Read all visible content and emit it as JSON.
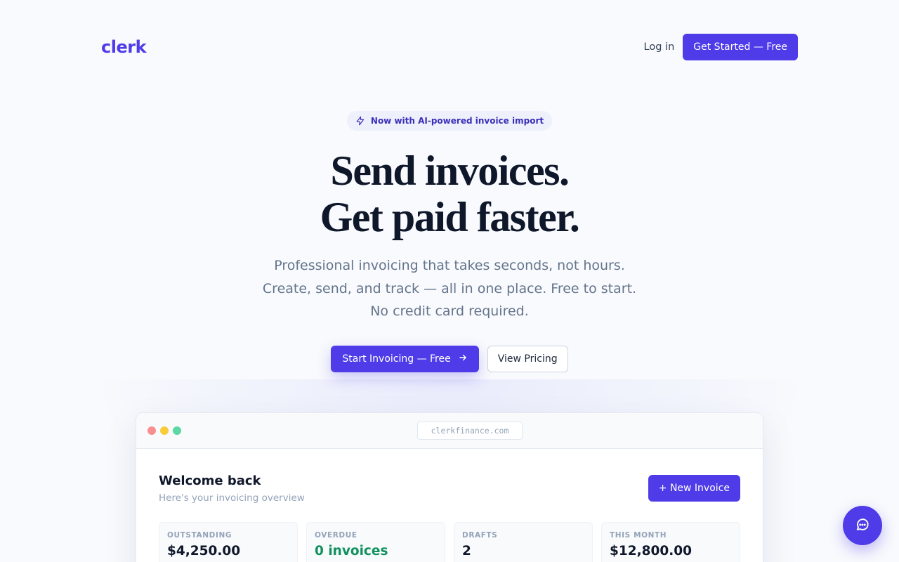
{
  "nav": {
    "logo": "clerk",
    "login_label": "Log in",
    "get_started_label": "Get Started — Free"
  },
  "hero": {
    "badge_text": "Now with AI-powered invoice import",
    "badge_icon": "lightning-icon",
    "headline_line1": "Send invoices.",
    "headline_line2": "Get paid faster.",
    "subtitle_line1": "Professional invoicing that takes seconds, not hours.",
    "subtitle_line2": "Create, send, and track — all in one place. Free to start.",
    "subtitle_line3": "No credit card required.",
    "cta_primary_label": "Start Invoicing — Free",
    "cta_primary_icon": "arrow-right-icon",
    "cta_secondary_label": "View Pricing"
  },
  "preview": {
    "url": "clerkfinance.com",
    "welcome_title": "Welcome back",
    "welcome_subtitle": "Here's your invoicing overview",
    "new_invoice_label": "+ New Invoice",
    "stats": [
      {
        "label": "OUTSTANDING",
        "value": "$4,250.00"
      },
      {
        "label": "OVERDUE",
        "value": "0 invoices"
      },
      {
        "label": "DRAFTS",
        "value": "2"
      },
      {
        "label": "THIS MONTH",
        "value": "$12,800.00"
      }
    ]
  },
  "chat": {
    "icon": "chat-icon"
  },
  "colors": {
    "brand": "#4f3ce8",
    "background": "#f8fafd",
    "success": "#10915e",
    "muted": "#64748b"
  }
}
